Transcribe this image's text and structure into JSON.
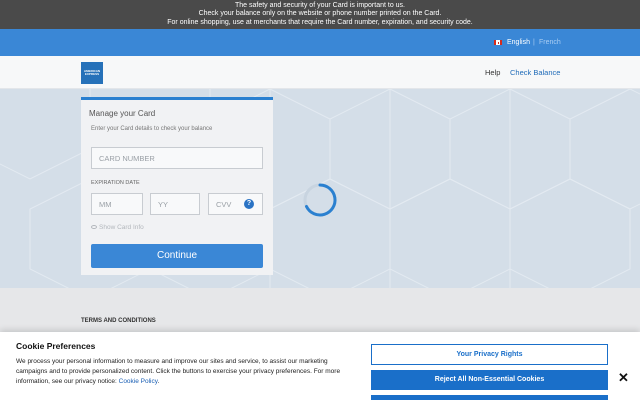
{
  "top_notice": {
    "line1": "The safety and security of your Card is important to us.",
    "line2": "Check your balance only on the website or phone number printed on the Card.",
    "line3": "For online shopping, use at merchants that require the Card number, expiration, and security code."
  },
  "language": {
    "english": "English",
    "separator": "|",
    "french": "French"
  },
  "header": {
    "logo_text": "AMERICAN EXPRESS",
    "help": "Help",
    "check_balance": "Check Balance"
  },
  "card": {
    "title": "Manage your Card",
    "subtitle": "Enter your Card details to check your balance",
    "card_number_placeholder": "CARD NUMBER",
    "expiration_label": "EXPIRATION DATE",
    "mm_placeholder": "MM",
    "yy_placeholder": "YY",
    "cvv_placeholder": "CVV",
    "help_glyph": "?",
    "show_info": "Show Card Info",
    "continue": "Continue"
  },
  "footer": {
    "terms": "TERMS AND CONDITIONS"
  },
  "cookie": {
    "title": "Cookie Preferences",
    "text": "We process your personal information to measure and improve our sites and service, to assist our marketing campaigns and to provide personalized content. Click the buttons to exercise your privacy preferences. For more information, see our privacy notice:",
    "link": "Cookie Policy",
    "link_suffix": ".",
    "privacy_rights": "Your Privacy Rights",
    "reject": "Reject All Non-Essential Cookies",
    "close": "✕"
  },
  "colors": {
    "accent": "#3a87d6",
    "top_bar": "#4a4a4a",
    "hero_bg": "#d4dee8"
  },
  "icons": {
    "flag": "canada-flag-icon",
    "help": "question-icon",
    "eye": "eye-icon",
    "spinner": "loading-spinner-icon",
    "close": "close-icon"
  }
}
